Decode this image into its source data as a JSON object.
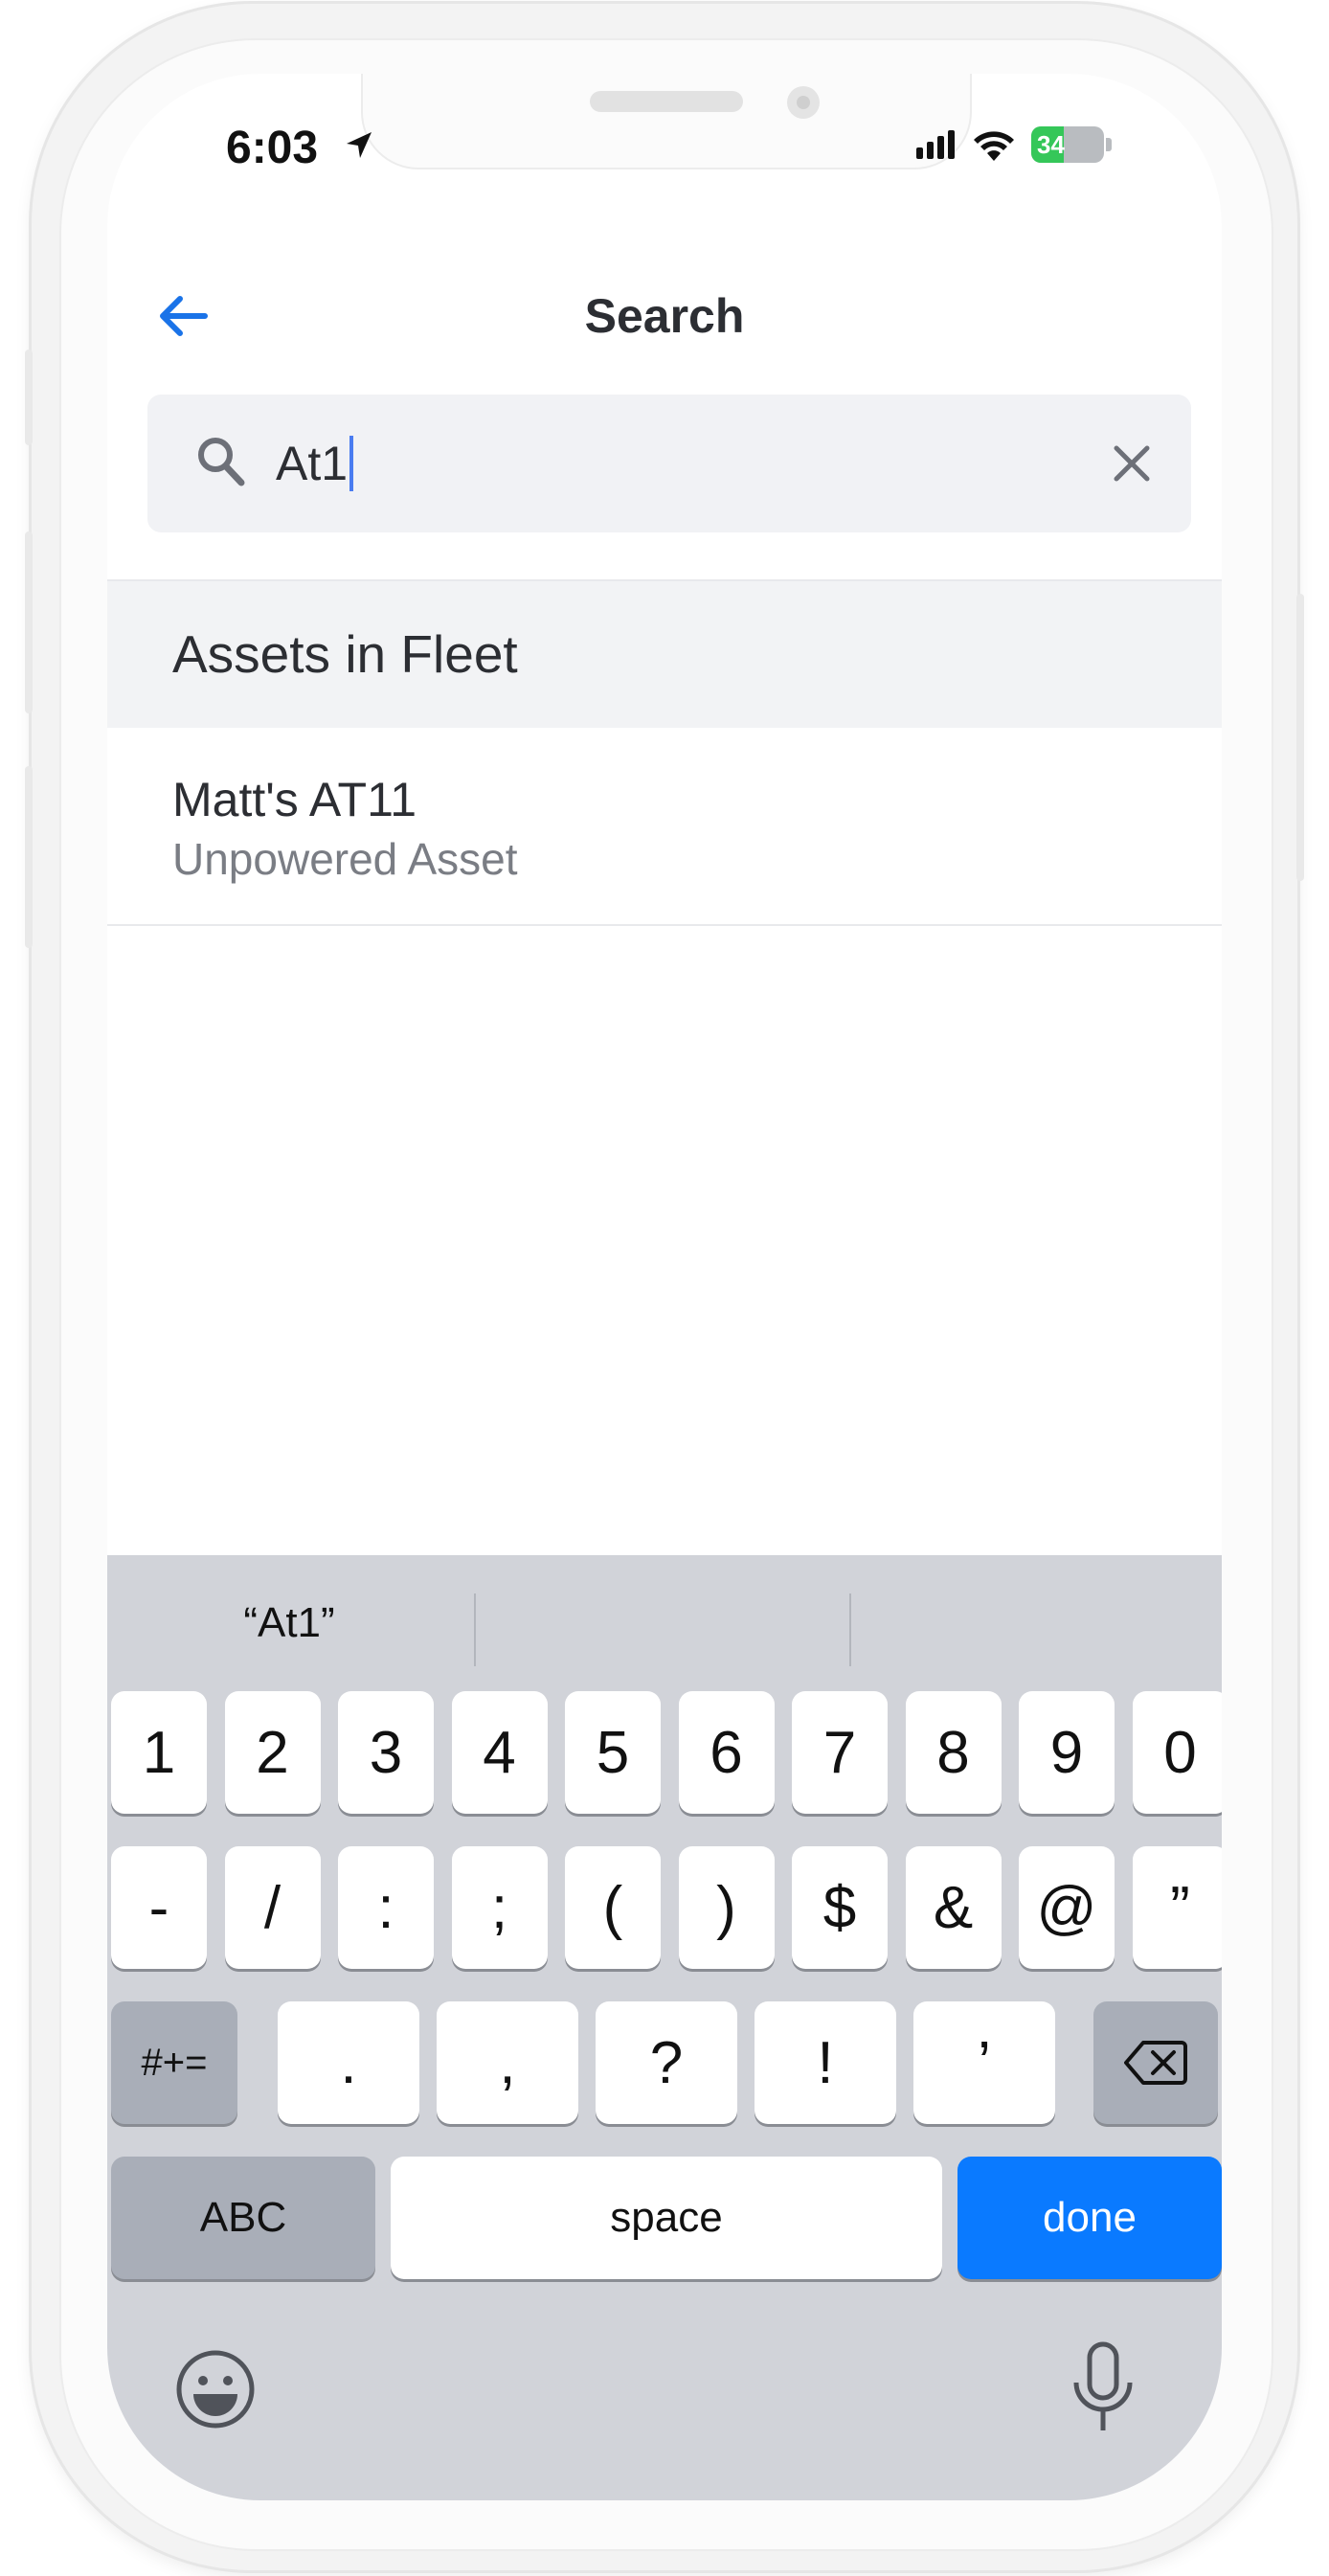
{
  "status_bar": {
    "time": "6:03",
    "battery": "34",
    "battery_color": "#35c759"
  },
  "header": {
    "title": "Search",
    "back_icon": "arrow-left-icon",
    "accent_color": "#1a73e8"
  },
  "search": {
    "value": "At1",
    "search_icon": "search-icon",
    "clear_icon": "close-icon"
  },
  "results": {
    "section_title": "Assets in Fleet",
    "items": [
      {
        "title": "Matt's AT11",
        "subtitle": "Unpowered Asset"
      }
    ]
  },
  "keyboard": {
    "suggestion": "“At1”",
    "row1": [
      "1",
      "2",
      "3",
      "4",
      "5",
      "6",
      "7",
      "8",
      "9",
      "0"
    ],
    "row2": [
      "-",
      "/",
      ":",
      ";",
      "(",
      ")",
      "$",
      "&",
      "@",
      "”"
    ],
    "row3_toggle": "#+=",
    "row3": [
      ".",
      ",",
      "?",
      "!",
      "’"
    ],
    "abc_label": "ABC",
    "space_label": "space",
    "done_label": "done",
    "done_color": "#0a7aff"
  }
}
